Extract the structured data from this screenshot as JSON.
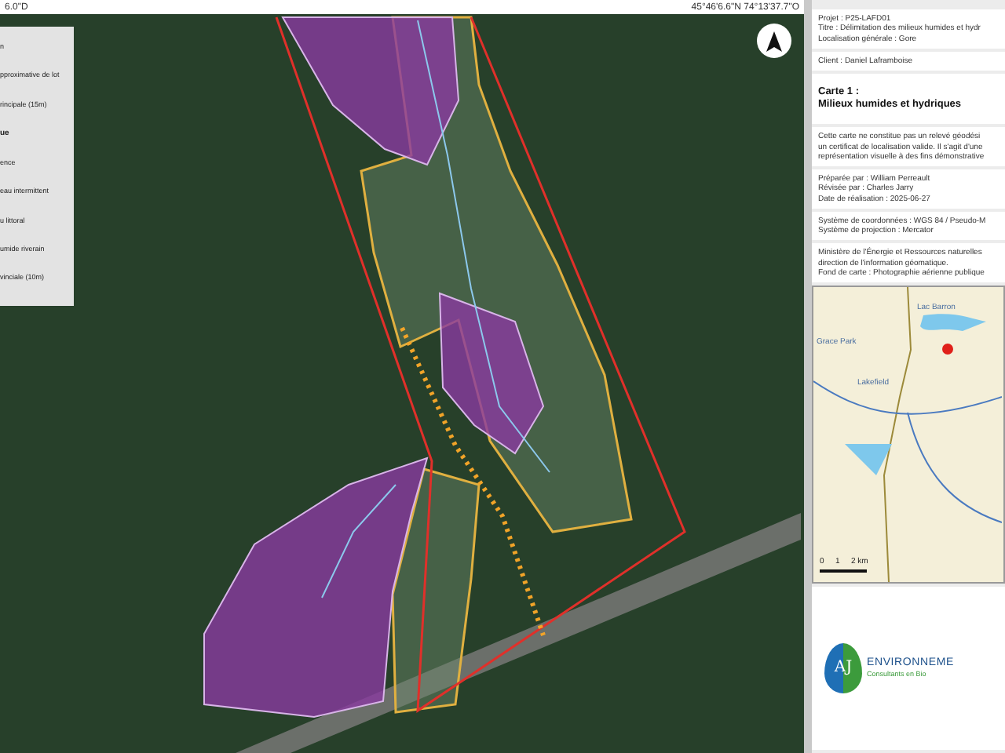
{
  "top_bar": {
    "left_text": "6.0\"D",
    "right_text": "45°46'6.6\"N 74°13'37.7\"O"
  },
  "legend": {
    "items": [
      {
        "label": "n",
        "kind": "item"
      },
      {
        "label": "pproximative de lot",
        "kind": "item"
      },
      {
        "label": "rincipale (15m)",
        "kind": "item"
      },
      {
        "label": "ue",
        "kind": "heading"
      },
      {
        "label": "ence",
        "kind": "item"
      },
      {
        "label": "eau intermittent",
        "kind": "item"
      },
      {
        "label": "u littoral",
        "kind": "item"
      },
      {
        "label": "umide riverain",
        "kind": "item"
      },
      {
        "label": "vinciale (10m)",
        "kind": "item"
      }
    ]
  },
  "panel": {
    "sections": [
      {
        "kind": "text",
        "lines": [
          "Projet : P25-LAFD01",
          "Titre : Délimitation des milieux humides et hydr",
          "Localisation générale : Gore"
        ]
      },
      {
        "kind": "text",
        "lines": [
          "Client : Daniel Laframboise"
        ]
      },
      {
        "kind": "title",
        "lines": [
          "Carte 1 :",
          "Milieux humides et hydriques"
        ]
      },
      {
        "kind": "text",
        "lines": [
          "Cette carte ne constitue pas un relevé géodési",
          "un certificat de localisation valide. Il s'agit d'une",
          "représentation visuelle à des fins démonstrative"
        ]
      },
      {
        "kind": "text",
        "lines": [
          "Préparée par : William Perreault",
          "Révisée par : Charles Jarry",
          "Date de réalisation : 2025-06-27"
        ]
      },
      {
        "kind": "text",
        "lines": [
          "Système de coordonnées : WGS 84 / Pseudo-M",
          "Système de projection : Mercator"
        ]
      },
      {
        "kind": "text",
        "lines": [
          "Ministère de l'Énergie et Ressources naturelles",
          "direction de l'information géomatique.",
          "Fond de carte : Photographie aérienne publique"
        ]
      },
      {
        "kind": "inset_map",
        "labels": [
          "Lac Barron",
          "Grace Park",
          "Lakefield"
        ],
        "scale": [
          "0",
          "1",
          "2 km"
        ]
      },
      {
        "kind": "logo",
        "mark": "AJ",
        "name": "ENVIRONNEME",
        "tagline": "Consultants en Bio"
      }
    ]
  }
}
